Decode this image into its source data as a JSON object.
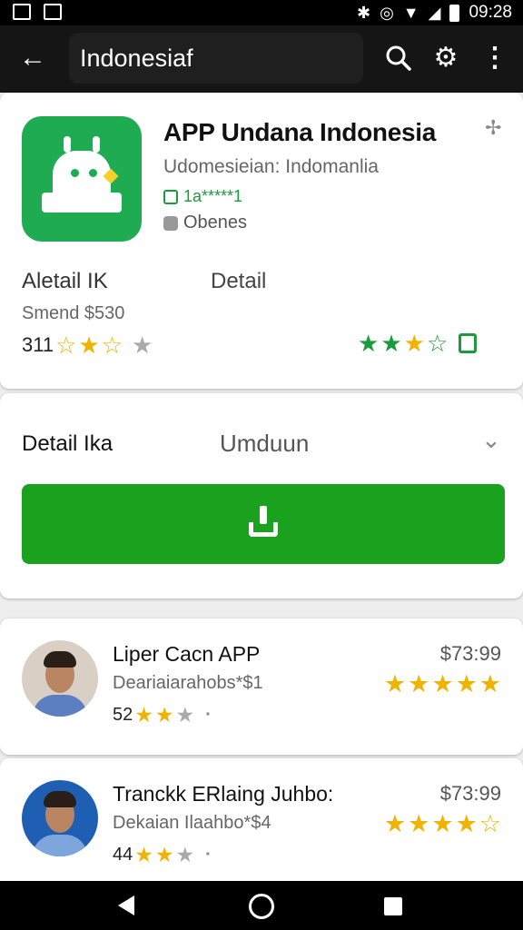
{
  "status": {
    "time": "09:28"
  },
  "appbar": {
    "search_text": "Indonesiaf"
  },
  "app": {
    "title": "APP Undana Indonesia",
    "developer": "Udomesieian: Indomanlia",
    "badge": "1a*****1",
    "size": "Obenes",
    "meta_left": "Aletail IK",
    "meta_mid": "Detail",
    "meta_sub": "Smend $530",
    "rating_count": "311",
    "rating_left": 2.5,
    "rating_right": 3.5
  },
  "detail": {
    "title": "Detail Ika",
    "action_label": "Umduun"
  },
  "rows": [
    {
      "title": "Liper Cacn APP",
      "subtitle": "Deariaiarahobs*$1",
      "count": "52",
      "rating": 2,
      "price": "$73:99",
      "stars": 5
    },
    {
      "title": "Tranckk ERlaing Juhbo:",
      "subtitle": "Dekaian Ilaahbo*$4",
      "count": "44",
      "rating": 2,
      "price": "$73:99",
      "stars": 4.5
    }
  ],
  "colors": {
    "accent": "#1aa11e",
    "icon_bg": "#1fab52",
    "star": "#f0b400"
  }
}
